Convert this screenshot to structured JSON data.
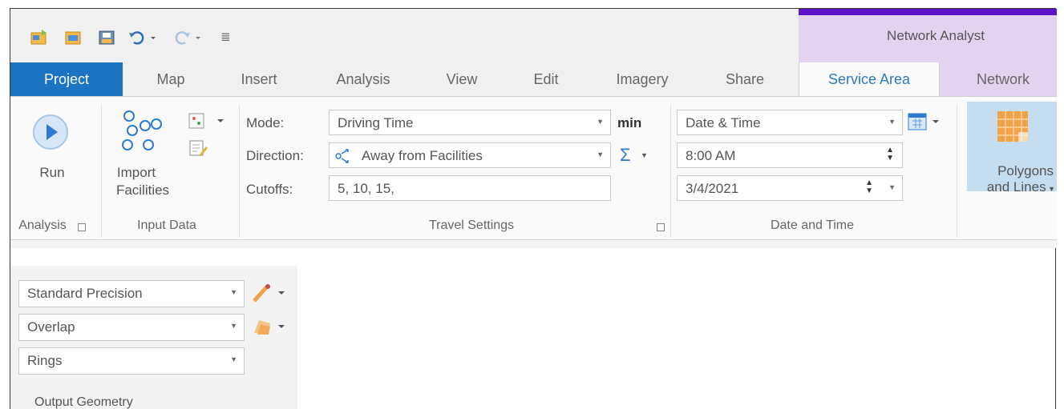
{
  "quick_access": {
    "icons": [
      "new-project-icon",
      "open-project-icon",
      "save-project-icon",
      "undo-icon",
      "redo-icon",
      "customize-qat-icon"
    ],
    "customize_glyph": "≣"
  },
  "contextual": {
    "label": "Network Analyst",
    "color": "#5b14c7"
  },
  "tabs": [
    {
      "label": "Project"
    },
    {
      "label": "Map"
    },
    {
      "label": "Insert"
    },
    {
      "label": "Analysis"
    },
    {
      "label": "View"
    },
    {
      "label": "Edit"
    },
    {
      "label": "Imagery"
    },
    {
      "label": "Share"
    },
    {
      "label": "Service Area"
    },
    {
      "label": "Network"
    }
  ],
  "ribbon": {
    "analysis": {
      "run_label": "Run",
      "group_label": "Analysis"
    },
    "input_data": {
      "import_label_1": "Import",
      "import_label_2": "Facilities",
      "group_label": "Input Data"
    },
    "travel_settings": {
      "mode_label": "Mode:",
      "mode_value": "Driving Time",
      "units": "min",
      "direction_label": "Direction:",
      "direction_value": "Away from Facilities",
      "cutoffs_label": "Cutoffs:",
      "cutoffs_value": "5, 10, 15,",
      "sigma": "Σ",
      "group_label": "Travel Settings"
    },
    "date_time": {
      "type_value": "Date & Time",
      "time_value": "8:00 AM",
      "date_value": "3/4/2021",
      "group_label": "Date and Time"
    },
    "output": {
      "polygons_label_1": "Polygons",
      "polygons_label_2": "and Lines"
    }
  },
  "output_geometry": {
    "precision_value": "Standard Precision",
    "overlap_value": "Overlap",
    "rings_value": "Rings",
    "group_label": "Output Geometry"
  },
  "colors": {
    "project_tab": "#1b73c4",
    "active_tab_text": "#2f7ac0",
    "contextual_bg": "#e3d3ef",
    "polygons_highlight": "#c6dcef"
  }
}
